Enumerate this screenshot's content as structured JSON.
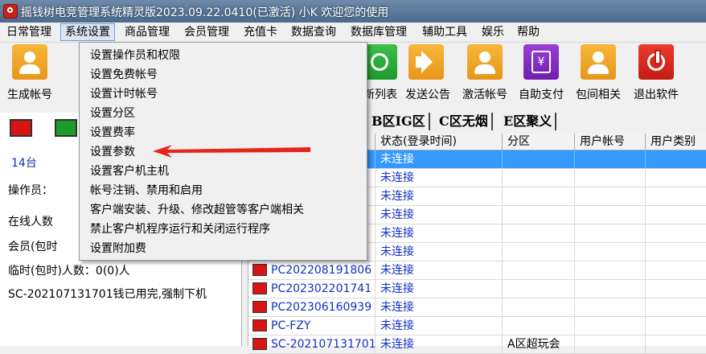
{
  "titlebar": {
    "title": "摇钱树电竞管理系统精灵版2023.09.22.0410(已激活)  小K 欢迎您的使用"
  },
  "menubar": {
    "items": [
      "日常管理",
      "系统设置",
      "商品管理",
      "会员管理",
      "充值卡",
      "数据查询",
      "数据库管理",
      "辅助工具",
      "娱乐",
      "帮助"
    ],
    "active": "系统设置"
  },
  "toolbar": {
    "items": [
      {
        "label": "生成帐号",
        "icon": "user-icon",
        "color": "#f0a52a"
      },
      {
        "label": "新列表",
        "icon": "refresh-icon",
        "color": "#2fb040"
      },
      {
        "label": "发送公告",
        "icon": "megaphone-icon",
        "color": "#f0a52a"
      },
      {
        "label": "激活帐号",
        "icon": "user-icon",
        "color": "#f0a52a"
      },
      {
        "label": "自助支付",
        "icon": "yen-icon",
        "color": "#8a32c8"
      },
      {
        "label": "包间相关",
        "icon": "user-icon",
        "color": "#f0a52a"
      },
      {
        "label": "退出软件",
        "icon": "power-icon",
        "color": "#d8271d"
      }
    ]
  },
  "dropdown": {
    "items": [
      "设置操作员和权限",
      "设置免费帐号",
      "设置计时帐号",
      "设置分区",
      "设置费率",
      "设置参数",
      "设置客户机主机",
      "帐号注销、禁用和启用",
      "客户端安装、升级、修改超管等客户端相关",
      "禁止客户机程序运行和关闭运行程序",
      "设置附加费"
    ]
  },
  "left_panel": {
    "count": "14台",
    "operator": "操作员：",
    "online": "在线人数",
    "member": "会员(包时",
    "temp": "临时(包时)人数：0(0)人",
    "notice": "SC-202107131701钱已用完,强制下机"
  },
  "tabs": [
    "B区IG区",
    "C区无烟",
    "E区聚义"
  ],
  "grid": {
    "columns": [
      "状态(登录时间)",
      "分区",
      "用户帐号",
      "用户类别"
    ],
    "rows": [
      {
        "name": "",
        "status": "未连接",
        "zone": "",
        "selected": true
      },
      {
        "name": "",
        "status": "未连接",
        "zone": ""
      },
      {
        "name": "",
        "status": "未连接",
        "zone": ""
      },
      {
        "name": "",
        "status": "未连接",
        "zone": ""
      },
      {
        "name": "",
        "status": "未连接",
        "zone": ""
      },
      {
        "name": "",
        "status": "未连接",
        "zone": ""
      },
      {
        "name": "PC202208191806",
        "status": "未连接",
        "zone": ""
      },
      {
        "name": "PC202302201741",
        "status": "未连接",
        "zone": ""
      },
      {
        "name": "PC202306160939",
        "status": "未连接",
        "zone": ""
      },
      {
        "name": "PC-FZY",
        "status": "未连接",
        "zone": ""
      },
      {
        "name": "SC-202107131701",
        "status": "未连接",
        "zone": "A区超玩会"
      }
    ]
  }
}
